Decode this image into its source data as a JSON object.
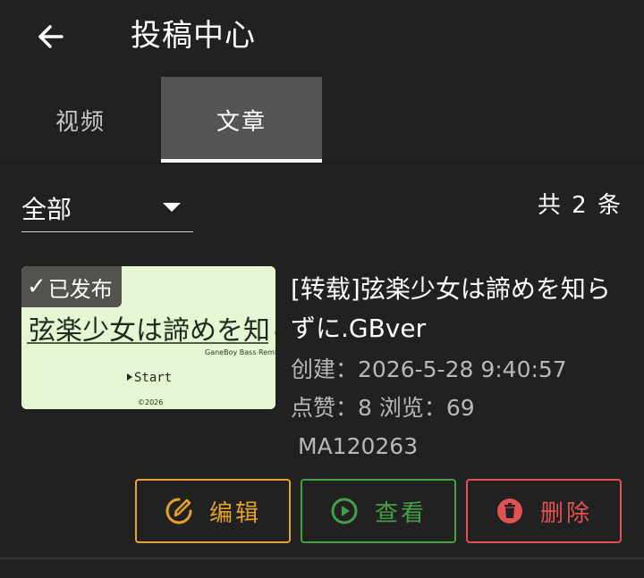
{
  "appbar": {
    "title": "投稿中心",
    "back_icon": "arrow-left-icon"
  },
  "tabs": [
    {
      "label": "视频",
      "active": false
    },
    {
      "label": "文章",
      "active": true
    }
  ],
  "filter": {
    "selected": "全部",
    "icon": "dropdown-triangle-icon"
  },
  "count_text": "共 2 条",
  "posts": [
    {
      "status": "已发布",
      "status_icon": "check-icon",
      "title": "[转载]弦楽少女は諦めを知らずに.GBver",
      "thumbnail": {
        "title_text": "弦楽少女は諦めを知らずに",
        "subtitle_text": "GaneBoy Bass Remix",
        "start_text": "Start",
        "copyright_text": "©2026"
      },
      "created": "创建：2026-5-28 9:40:57",
      "stats": "点赞：8  浏览：69",
      "id": "MA120263",
      "actions": {
        "edit": {
          "label": "编辑",
          "icon": "edit-icon"
        },
        "view": {
          "label": "查看",
          "icon": "play-circle-icon"
        },
        "delete": {
          "label": "删除",
          "icon": "trash-icon"
        }
      }
    }
  ],
  "colors": {
    "background": "#212121",
    "tab_active": "#555555",
    "edit": "#e5a22a",
    "view": "#43a047",
    "delete": "#e25252",
    "thumbnail_bg": "#e6f6d2"
  }
}
